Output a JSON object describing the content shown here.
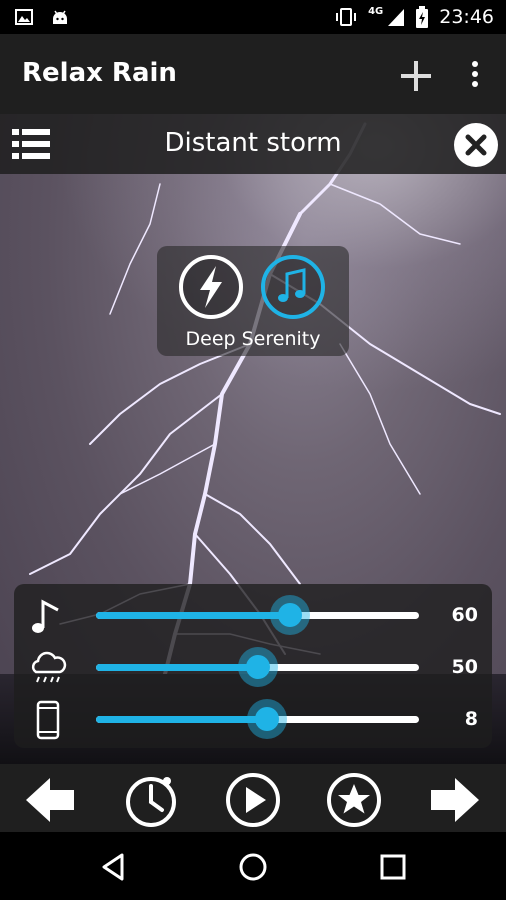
{
  "status": {
    "time": "23:46",
    "network": "4G",
    "icons": [
      "gallery-icon",
      "android-icon",
      "vibrate-icon",
      "signal-icon",
      "battery-charging-icon"
    ]
  },
  "appbar": {
    "title": "Relax Rain",
    "actions": [
      "add-icon",
      "more-vert-icon"
    ]
  },
  "scene": {
    "title": "Distant storm",
    "left_icon": "list-icon",
    "right_icon": "close-circle-icon"
  },
  "mode": {
    "label": "Deep Serenity",
    "buttons": [
      {
        "icon": "lightning-icon",
        "active": false
      },
      {
        "icon": "music-note-icon",
        "active": true
      }
    ]
  },
  "mixer": {
    "rows": [
      {
        "icon": "music-note-icon",
        "value": 60,
        "display": "60",
        "fraction": 0.6
      },
      {
        "icon": "rain-cloud-icon",
        "value": 50,
        "display": "50",
        "fraction": 0.5
      },
      {
        "icon": "phone-icon",
        "value": 8,
        "display": "8",
        "fraction": 0.53
      }
    ]
  },
  "controls": {
    "buttons": [
      "arrow-left-icon",
      "timer-icon",
      "play-icon",
      "star-icon",
      "arrow-right-icon"
    ]
  },
  "colors": {
    "accent": "#1fb3e6",
    "bar": "#1f1f1f"
  }
}
